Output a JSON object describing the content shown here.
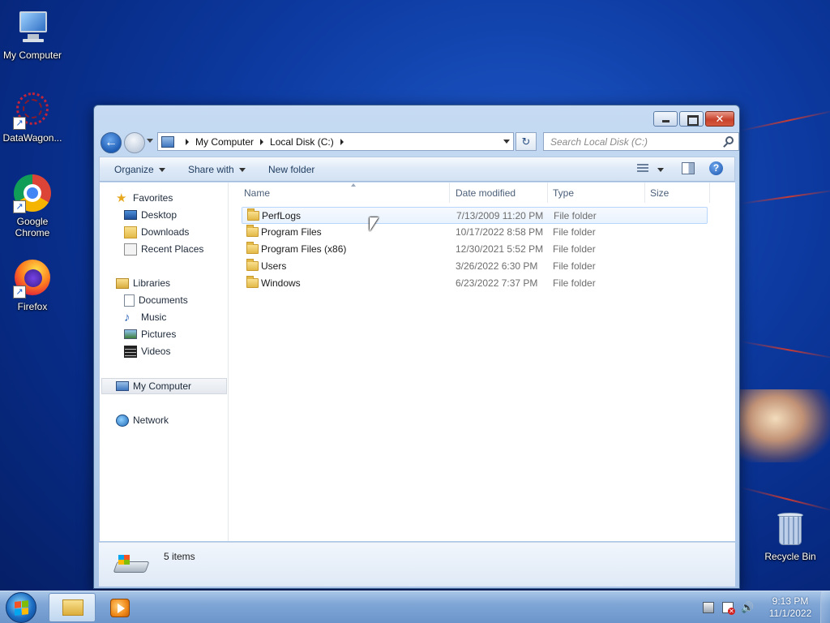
{
  "desktop": {
    "icons": [
      {
        "label": "My Computer"
      },
      {
        "label": "DataWagon..."
      },
      {
        "label": "Google Chrome"
      },
      {
        "label": "Firefox"
      },
      {
        "label": "Recycle Bin"
      }
    ]
  },
  "window": {
    "controls": {
      "minimize": "",
      "maximize": "",
      "close": "✕"
    },
    "back_glyph": "←",
    "refresh_glyph": "↻",
    "breadcrumb": [
      "My Computer",
      "Local Disk (C:)"
    ],
    "search_placeholder": "Search Local Disk (C:)",
    "toolbar": {
      "organize": "Organize",
      "share_with": "Share with",
      "new_folder": "New folder",
      "help": "?"
    },
    "nav": {
      "favorites": "Favorites",
      "desktop": "Desktop",
      "downloads": "Downloads",
      "recent_places": "Recent Places",
      "libraries": "Libraries",
      "documents": "Documents",
      "music": "Music",
      "pictures": "Pictures",
      "videos": "Videos",
      "my_computer": "My Computer",
      "network": "Network"
    },
    "columns": {
      "name": "Name",
      "date_modified": "Date modified",
      "type": "Type",
      "size": "Size"
    },
    "files": [
      {
        "name": "PerfLogs",
        "date": "7/13/2009 11:20 PM",
        "type": "File folder"
      },
      {
        "name": "Program Files",
        "date": "10/17/2022 8:58 PM",
        "type": "File folder"
      },
      {
        "name": "Program Files (x86)",
        "date": "12/30/2021 5:52 PM",
        "type": "File folder"
      },
      {
        "name": "Users",
        "date": "3/26/2022 6:30 PM",
        "type": "File folder"
      },
      {
        "name": "Windows",
        "date": "6/23/2022 7:37 PM",
        "type": "File folder"
      }
    ],
    "status": {
      "item_count": "5 items"
    }
  },
  "taskbar": {
    "clock_time": "9:13 PM",
    "clock_date": "11/1/2022"
  }
}
